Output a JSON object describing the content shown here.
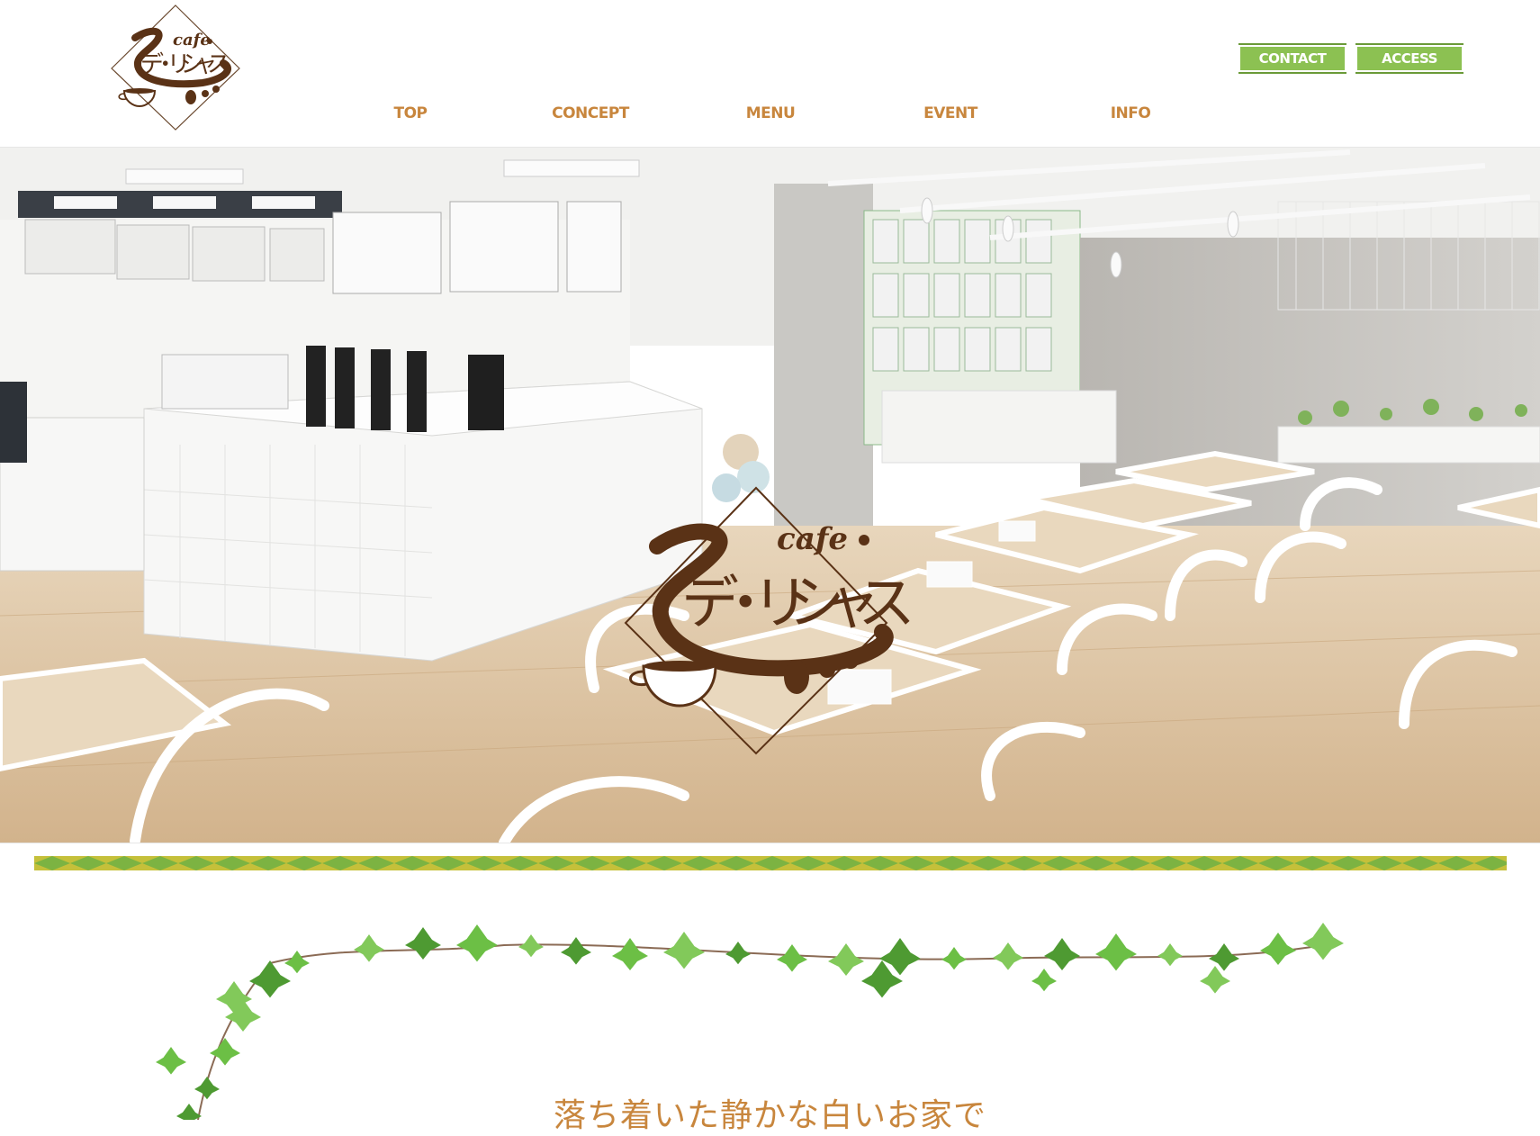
{
  "header": {
    "logo_alt": "cafe デ・リシャス",
    "logo_word": "cafe",
    "logo_kana": "デ・リシャス",
    "contact_label": "CONTACT",
    "access_label": "ACCESS"
  },
  "nav": {
    "items": [
      {
        "label": "TOP"
      },
      {
        "label": "CONCEPT"
      },
      {
        "label": "MENU"
      },
      {
        "label": "EVENT"
      },
      {
        "label": "INFO"
      }
    ]
  },
  "hero": {
    "logo_word": "cafe",
    "logo_kana": "デ・リシャス"
  },
  "main": {
    "headline": "落ち着いた静かな白いお家で"
  },
  "colors": {
    "brand_brown": "#5a3216",
    "nav_orange": "#c8863d",
    "button_green": "#8cc152",
    "band_green": "#7cb342",
    "band_yellow": "#c5c03a"
  }
}
